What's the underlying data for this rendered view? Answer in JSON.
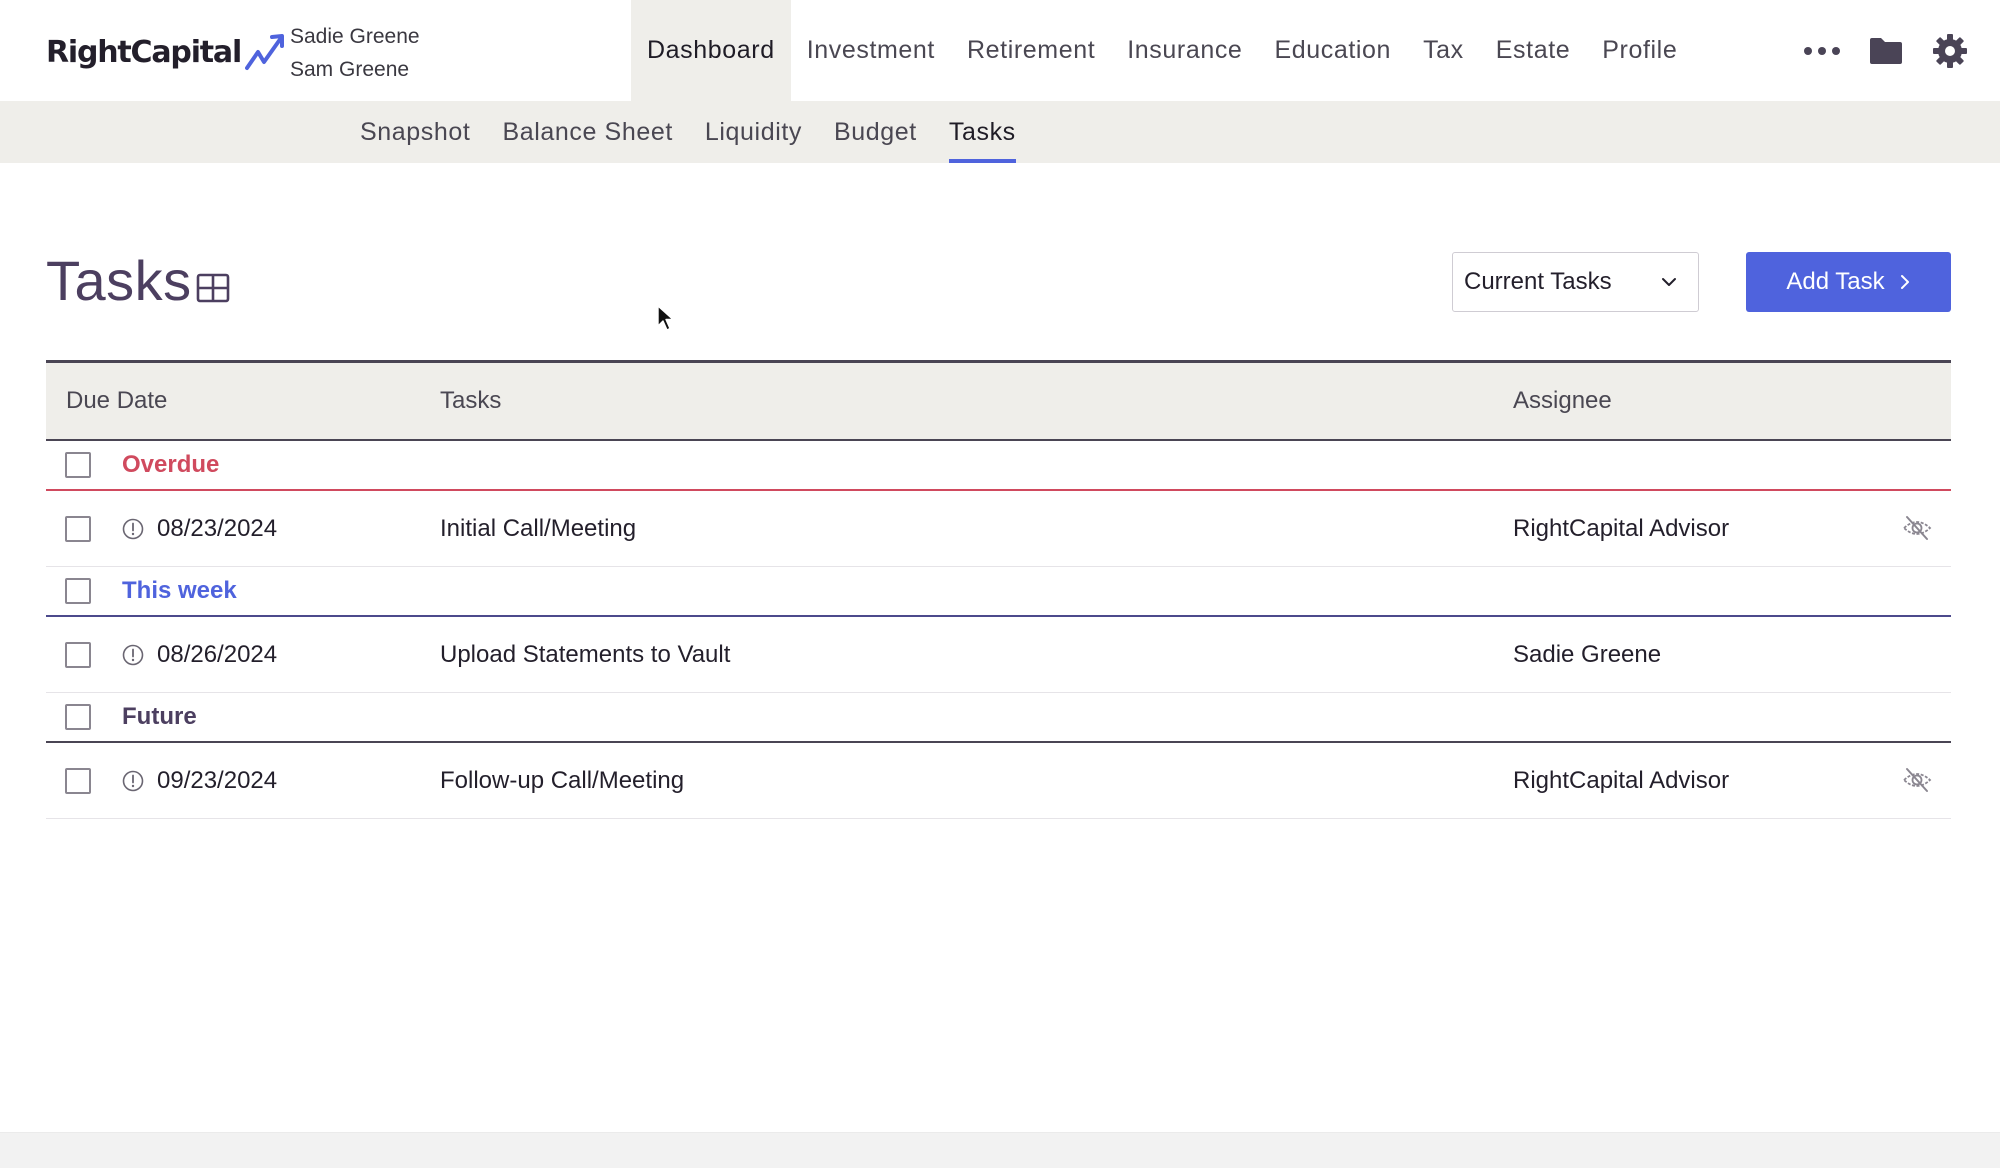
{
  "brand": {
    "name": "RightCapital",
    "accent": "#4f63dd"
  },
  "clients": [
    "Sadie Greene",
    "Sam Greene"
  ],
  "main_nav": [
    "Dashboard",
    "Investment",
    "Retirement",
    "Insurance",
    "Education",
    "Tax",
    "Estate",
    "Profile"
  ],
  "main_nav_active": "Dashboard",
  "top_icons": [
    "more-dots-icon",
    "folder-icon",
    "gear-icon"
  ],
  "sub_nav": [
    "Snapshot",
    "Balance Sheet",
    "Liquidity",
    "Budget",
    "Tasks"
  ],
  "sub_nav_active": "Tasks",
  "page": {
    "title": "Tasks",
    "filter": {
      "selected": "Current Tasks"
    },
    "add_button": "Add Task"
  },
  "table": {
    "columns": [
      "Due Date",
      "Tasks",
      "Assignee"
    ],
    "groups": [
      {
        "label": "Overdue",
        "color": "#d04a5e",
        "tasks": [
          {
            "due": "08/23/2024",
            "task": "Initial Call/Meeting",
            "assignee": "RightCapital Advisor",
            "hidden_icon": true
          }
        ]
      },
      {
        "label": "This week",
        "color": "#4f63dd",
        "tasks": [
          {
            "due": "08/26/2024",
            "task": "Upload Statements to Vault",
            "assignee": "Sadie Greene",
            "hidden_icon": false
          }
        ]
      },
      {
        "label": "Future",
        "color": "#4c3f60",
        "tasks": [
          {
            "due": "09/23/2024",
            "task": "Follow-up Call/Meeting",
            "assignee": "RightCapital Advisor",
            "hidden_icon": true
          }
        ]
      }
    ]
  }
}
